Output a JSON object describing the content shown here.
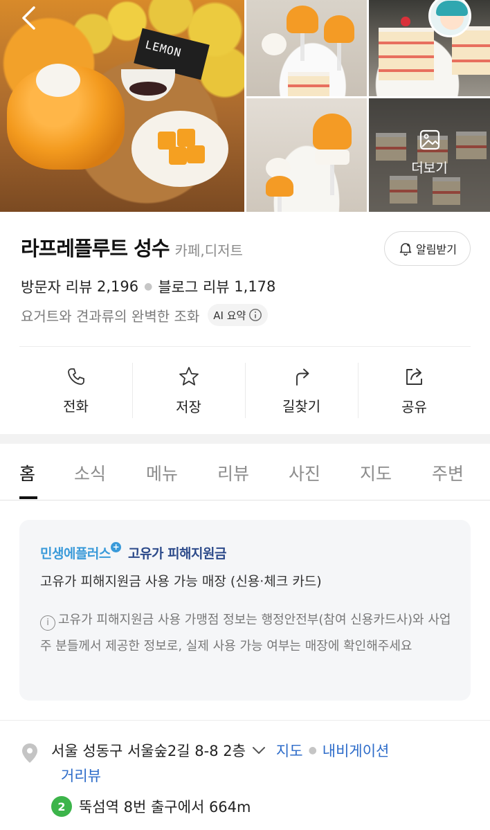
{
  "gallery": {
    "sign_text": "LEMON",
    "more_label": "더보기"
  },
  "place": {
    "name": "라프레플루트 성수",
    "category": "카페,디저트",
    "alarm_label": "알림받기",
    "visitor_review_label": "방문자 리뷰",
    "visitor_review_count": "2,196",
    "blog_review_label": "블로그 리뷰",
    "blog_review_count": "1,178",
    "summary": "요거트와 견과류의 완벽한 조화",
    "ai_badge": "AI 요약"
  },
  "actions": [
    {
      "label": "전화",
      "icon": "phone-icon"
    },
    {
      "label": "저장",
      "icon": "star-icon"
    },
    {
      "label": "길찾기",
      "icon": "directions-icon"
    },
    {
      "label": "공유",
      "icon": "share-icon"
    }
  ],
  "tabs": [
    {
      "label": "홈",
      "active": true
    },
    {
      "label": "소식"
    },
    {
      "label": "메뉴"
    },
    {
      "label": "리뷰"
    },
    {
      "label": "사진"
    },
    {
      "label": "지도"
    },
    {
      "label": "주변"
    }
  ],
  "notice": {
    "brand": "민생에플러스",
    "title": "고유가 피해지원금",
    "subtitle": "고유가 피해지원금 사용 가능 매장 (신용·체크 카드)",
    "info": "고유가 피해지원금 사용 가맹점 정보는 행정안전부(참여 신용카드사)와 사업주 분들께서 제공한 정보로, 실제 사용 가능 여부는 매장에 확인해주세요"
  },
  "address": {
    "text": "서울 성동구 서울숲2길 8-8 2층",
    "map_link": "지도",
    "nav_link": "내비게이션",
    "street_view_link": "거리뷰"
  },
  "subway": {
    "line": "2",
    "line_color": "#3cb44a",
    "text": "뚝섬역 8번 출구에서 664m"
  },
  "colors": {
    "link": "#2c6bc9",
    "brand": "#3a9ad9"
  }
}
